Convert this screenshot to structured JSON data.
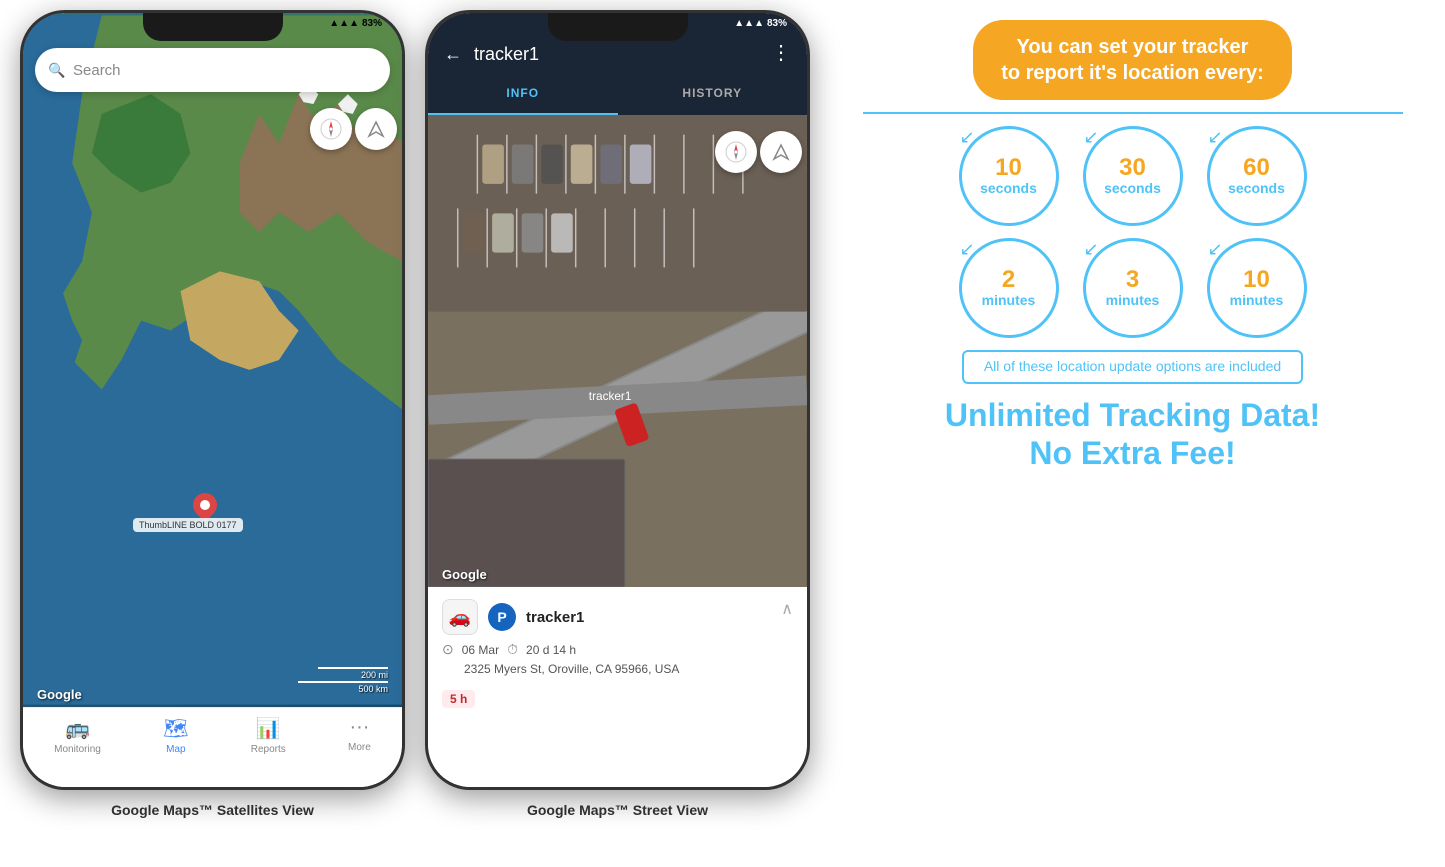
{
  "page": {
    "background": "#ffffff"
  },
  "phone1": {
    "status_bar": {
      "signal": "|||",
      "wifi": "▲",
      "battery": "83%"
    },
    "search_placeholder": "Search",
    "compass_symbol": "🧭",
    "nav_symbol": "➤",
    "google_watermark": "Google",
    "tracker_label": "ThumbLINE BOLD 0177",
    "scale_labels": [
      "200 mi",
      "500 km"
    ],
    "bottom_nav": [
      {
        "label": "Monitoring",
        "icon": "🚌",
        "active": false
      },
      {
        "label": "Map",
        "icon": "🗺",
        "active": true
      },
      {
        "label": "Reports",
        "icon": "📊",
        "active": false
      },
      {
        "label": "More",
        "icon": "···",
        "active": false
      }
    ],
    "caption": "Google Maps™ Satellites View"
  },
  "phone2": {
    "status_bar": {
      "signal": "|||",
      "wifi": "▲",
      "battery": "83%"
    },
    "back_icon": "←",
    "title": "tracker1",
    "menu_icon": "⋮",
    "tabs": [
      {
        "label": "INFO",
        "active": true
      },
      {
        "label": "HISTORY",
        "active": false
      }
    ],
    "google_watermark": "Google",
    "info_panel": {
      "tracker_name": "tracker1",
      "parking_label": "P",
      "date": "06 Mar",
      "duration": "20 d 14 h",
      "address": "2325 Myers St, Oroville, CA 95966, USA",
      "time_badge": "5 h"
    },
    "caption": "Google Maps™ Street View"
  },
  "info_section": {
    "headline": "You can set your tracker\nto report it's location every:",
    "divider_color": "#4fc3f7",
    "intervals_row1": [
      {
        "number": "10",
        "unit": "seconds"
      },
      {
        "number": "30",
        "unit": "seconds"
      },
      {
        "number": "60",
        "unit": "seconds"
      }
    ],
    "intervals_row2": [
      {
        "number": "2",
        "unit": "minutes"
      },
      {
        "number": "3",
        "unit": "minutes"
      },
      {
        "number": "10",
        "unit": "minutes"
      }
    ],
    "included_text": "All of these location update options are included",
    "unlimited_line1": "Unlimited Tracking Data!",
    "unlimited_line2": "No Extra Fee!"
  }
}
